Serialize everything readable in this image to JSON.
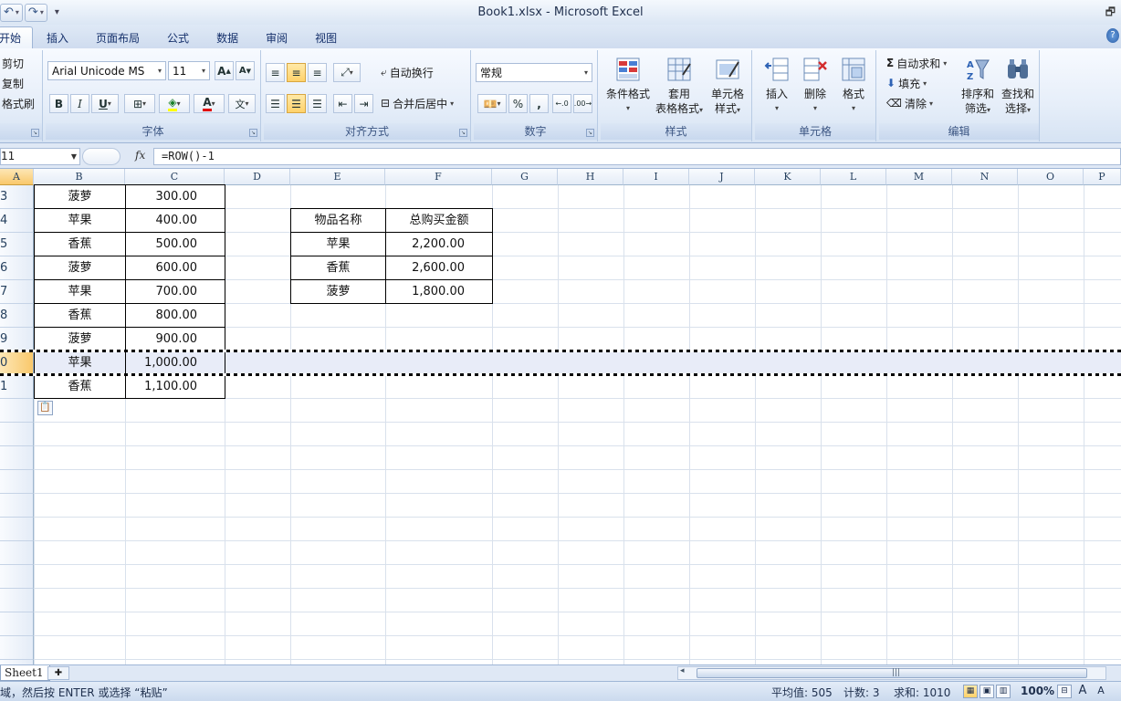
{
  "window": {
    "title": "Book1.xlsx - Microsoft Excel"
  },
  "qat": {
    "undo_icon": "undo-icon",
    "redo_icon": "redo-icon"
  },
  "tabs": [
    "开始",
    "插入",
    "页面布局",
    "公式",
    "数据",
    "审阅",
    "视图"
  ],
  "ribbon": {
    "clipboard": {
      "cut": "剪切",
      "copy": "复制",
      "format_painter": "格式刷"
    },
    "font": {
      "label": "字体",
      "font_name": "Arial Unicode MS",
      "font_size": "11",
      "bold": "B",
      "italic": "I",
      "underline": "U",
      "grow": "A",
      "shrink": "A",
      "font_color": "A"
    },
    "alignment": {
      "label": "对齐方式",
      "wrap": "自动换行",
      "merge": "合并后居中"
    },
    "number": {
      "label": "数字",
      "format": "常规",
      "percent": "%",
      "comma": ","
    },
    "styles": {
      "label": "样式",
      "conditional": "条件格式",
      "table_1": "套用",
      "table_2": "表格格式",
      "cell_1": "单元格",
      "cell_2": "样式"
    },
    "cells": {
      "label": "单元格",
      "insert": "插入",
      "delete": "删除",
      "format": "格式"
    },
    "editing": {
      "label": "编辑",
      "autosum": "自动求和",
      "fill": "填充",
      "clear": "清除",
      "sort_1": "排序和",
      "sort_2": "筛选",
      "find_1": "查找和",
      "find_2": "选择"
    }
  },
  "formula_bar": {
    "name_box": "11",
    "fx": "fx",
    "formula": "=ROW()-1"
  },
  "columns": [
    "A",
    "B",
    "C",
    "D",
    "E",
    "F",
    "G",
    "H",
    "I",
    "J",
    "K",
    "L",
    "M",
    "N",
    "O",
    "P"
  ],
  "rows": [
    {
      "header": "3",
      "b": "菠萝",
      "c": "300.00"
    },
    {
      "header": "4",
      "b": "苹果",
      "c": "400.00"
    },
    {
      "header": "5",
      "b": "香蕉",
      "c": "500.00"
    },
    {
      "header": "6",
      "b": "菠萝",
      "c": "600.00"
    },
    {
      "header": "7",
      "b": "苹果",
      "c": "700.00"
    },
    {
      "header": "8",
      "b": "香蕉",
      "c": "800.00"
    },
    {
      "header": "9",
      "b": "菠萝",
      "c": "900.00"
    },
    {
      "header": "0",
      "b": "苹果",
      "c": "1,000.00"
    },
    {
      "header": "1",
      "b": "香蕉",
      "c": "1,100.00"
    }
  ],
  "summary_table": {
    "headers": [
      "物品名称",
      "总购买金额"
    ],
    "rows": [
      [
        "苹果",
        "2,200.00"
      ],
      [
        "香蕉",
        "2,600.00"
      ],
      [
        "菠萝",
        "1,800.00"
      ]
    ]
  },
  "sheet_tab": "Sheet1",
  "status": {
    "message": "域，然后按 ENTER 或选择 “粘贴”",
    "average": "平均值: 505",
    "count": "计数: 3",
    "sum": "求和: 1010",
    "zoom": "100%"
  }
}
